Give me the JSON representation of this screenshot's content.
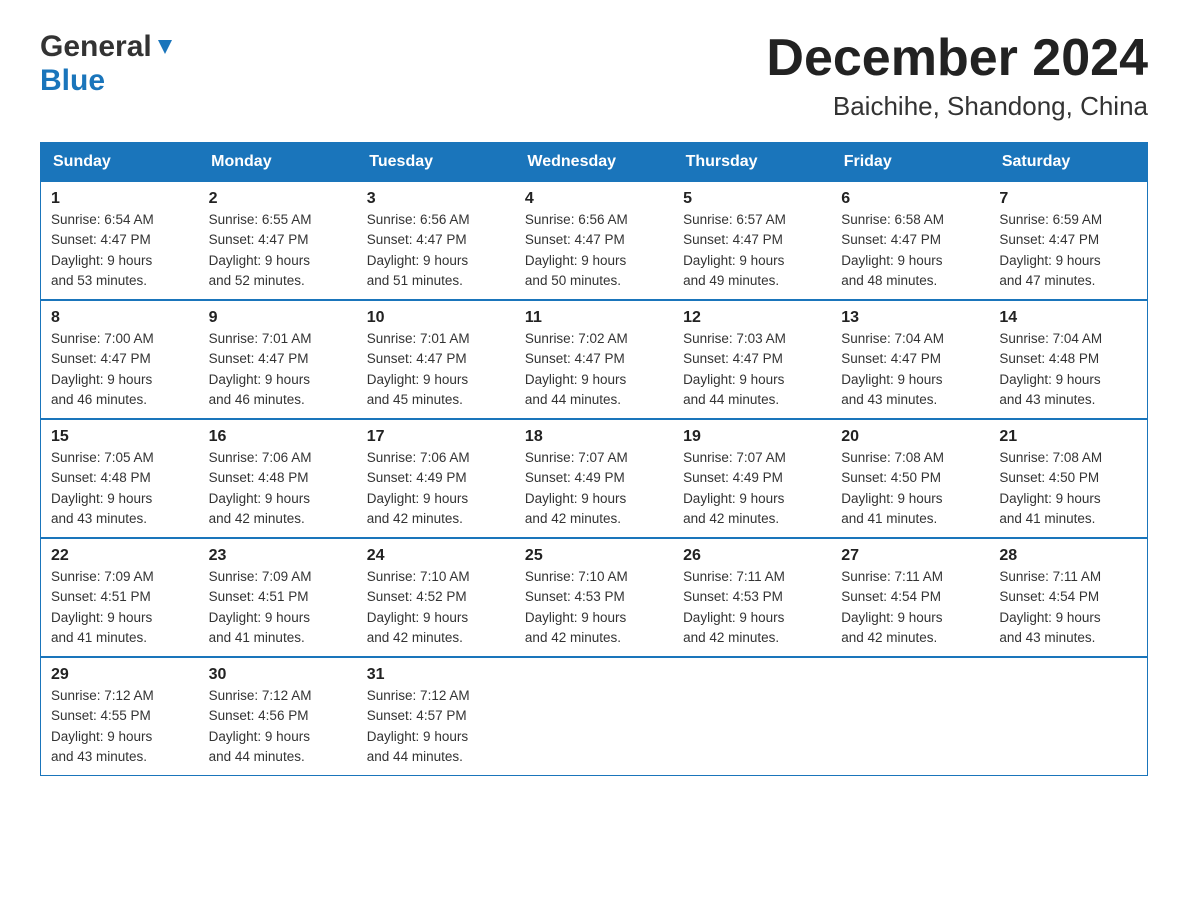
{
  "logo": {
    "line1": "General",
    "line2": "Blue"
  },
  "title": "December 2024",
  "subtitle": "Baichihe, Shandong, China",
  "days_of_week": [
    "Sunday",
    "Monday",
    "Tuesday",
    "Wednesday",
    "Thursday",
    "Friday",
    "Saturday"
  ],
  "weeks": [
    [
      {
        "day": "1",
        "sunrise": "6:54 AM",
        "sunset": "4:47 PM",
        "daylight": "9 hours and 53 minutes."
      },
      {
        "day": "2",
        "sunrise": "6:55 AM",
        "sunset": "4:47 PM",
        "daylight": "9 hours and 52 minutes."
      },
      {
        "day": "3",
        "sunrise": "6:56 AM",
        "sunset": "4:47 PM",
        "daylight": "9 hours and 51 minutes."
      },
      {
        "day": "4",
        "sunrise": "6:56 AM",
        "sunset": "4:47 PM",
        "daylight": "9 hours and 50 minutes."
      },
      {
        "day": "5",
        "sunrise": "6:57 AM",
        "sunset": "4:47 PM",
        "daylight": "9 hours and 49 minutes."
      },
      {
        "day": "6",
        "sunrise": "6:58 AM",
        "sunset": "4:47 PM",
        "daylight": "9 hours and 48 minutes."
      },
      {
        "day": "7",
        "sunrise": "6:59 AM",
        "sunset": "4:47 PM",
        "daylight": "9 hours and 47 minutes."
      }
    ],
    [
      {
        "day": "8",
        "sunrise": "7:00 AM",
        "sunset": "4:47 PM",
        "daylight": "9 hours and 46 minutes."
      },
      {
        "day": "9",
        "sunrise": "7:01 AM",
        "sunset": "4:47 PM",
        "daylight": "9 hours and 46 minutes."
      },
      {
        "day": "10",
        "sunrise": "7:01 AM",
        "sunset": "4:47 PM",
        "daylight": "9 hours and 45 minutes."
      },
      {
        "day": "11",
        "sunrise": "7:02 AM",
        "sunset": "4:47 PM",
        "daylight": "9 hours and 44 minutes."
      },
      {
        "day": "12",
        "sunrise": "7:03 AM",
        "sunset": "4:47 PM",
        "daylight": "9 hours and 44 minutes."
      },
      {
        "day": "13",
        "sunrise": "7:04 AM",
        "sunset": "4:47 PM",
        "daylight": "9 hours and 43 minutes."
      },
      {
        "day": "14",
        "sunrise": "7:04 AM",
        "sunset": "4:48 PM",
        "daylight": "9 hours and 43 minutes."
      }
    ],
    [
      {
        "day": "15",
        "sunrise": "7:05 AM",
        "sunset": "4:48 PM",
        "daylight": "9 hours and 43 minutes."
      },
      {
        "day": "16",
        "sunrise": "7:06 AM",
        "sunset": "4:48 PM",
        "daylight": "9 hours and 42 minutes."
      },
      {
        "day": "17",
        "sunrise": "7:06 AM",
        "sunset": "4:49 PM",
        "daylight": "9 hours and 42 minutes."
      },
      {
        "day": "18",
        "sunrise": "7:07 AM",
        "sunset": "4:49 PM",
        "daylight": "9 hours and 42 minutes."
      },
      {
        "day": "19",
        "sunrise": "7:07 AM",
        "sunset": "4:49 PM",
        "daylight": "9 hours and 42 minutes."
      },
      {
        "day": "20",
        "sunrise": "7:08 AM",
        "sunset": "4:50 PM",
        "daylight": "9 hours and 41 minutes."
      },
      {
        "day": "21",
        "sunrise": "7:08 AM",
        "sunset": "4:50 PM",
        "daylight": "9 hours and 41 minutes."
      }
    ],
    [
      {
        "day": "22",
        "sunrise": "7:09 AM",
        "sunset": "4:51 PM",
        "daylight": "9 hours and 41 minutes."
      },
      {
        "day": "23",
        "sunrise": "7:09 AM",
        "sunset": "4:51 PM",
        "daylight": "9 hours and 41 minutes."
      },
      {
        "day": "24",
        "sunrise": "7:10 AM",
        "sunset": "4:52 PM",
        "daylight": "9 hours and 42 minutes."
      },
      {
        "day": "25",
        "sunrise": "7:10 AM",
        "sunset": "4:53 PM",
        "daylight": "9 hours and 42 minutes."
      },
      {
        "day": "26",
        "sunrise": "7:11 AM",
        "sunset": "4:53 PM",
        "daylight": "9 hours and 42 minutes."
      },
      {
        "day": "27",
        "sunrise": "7:11 AM",
        "sunset": "4:54 PM",
        "daylight": "9 hours and 42 minutes."
      },
      {
        "day": "28",
        "sunrise": "7:11 AM",
        "sunset": "4:54 PM",
        "daylight": "9 hours and 43 minutes."
      }
    ],
    [
      {
        "day": "29",
        "sunrise": "7:12 AM",
        "sunset": "4:55 PM",
        "daylight": "9 hours and 43 minutes."
      },
      {
        "day": "30",
        "sunrise": "7:12 AM",
        "sunset": "4:56 PM",
        "daylight": "9 hours and 44 minutes."
      },
      {
        "day": "31",
        "sunrise": "7:12 AM",
        "sunset": "4:57 PM",
        "daylight": "9 hours and 44 minutes."
      },
      null,
      null,
      null,
      null
    ]
  ],
  "cell_labels": {
    "sunrise": "Sunrise: ",
    "sunset": "Sunset: ",
    "daylight": "Daylight: "
  }
}
